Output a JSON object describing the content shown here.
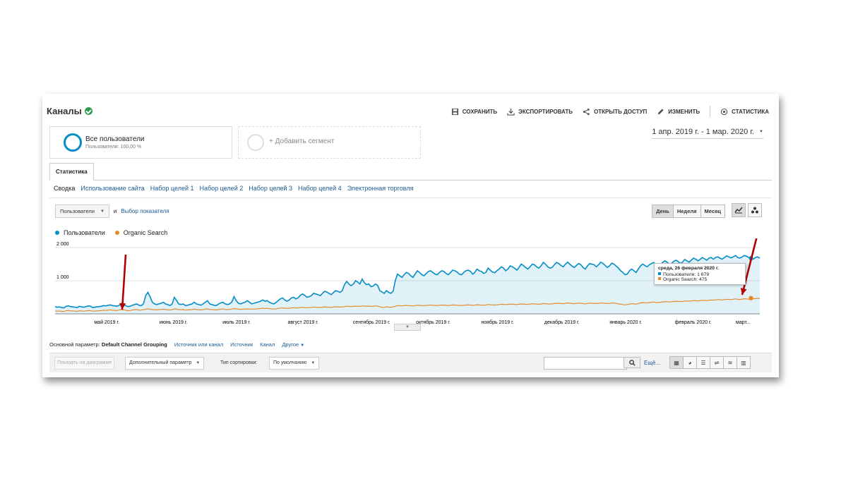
{
  "header": {
    "title": "Каналы",
    "actions": [
      {
        "label": "СОХРАНИТЬ",
        "icon": "save-icon"
      },
      {
        "label": "ЭКСПОРТИРОВАТЬ",
        "icon": "export-icon"
      },
      {
        "label": "ОТКРЫТЬ ДОСТУП",
        "icon": "share-icon"
      },
      {
        "label": "ИЗМЕНИТЬ",
        "icon": "pencil-icon"
      },
      {
        "label": "СТАТИСТИКА",
        "icon": "insights-icon"
      }
    ]
  },
  "segments": {
    "active": {
      "title": "Все пользователи",
      "subtitle": "Пользователи: 100,00 %"
    },
    "add_label": "+ Добавить сегмент"
  },
  "date_range": "1 апр. 2019 г. - 1 мар. 2020 г.",
  "tabs": [
    "Статистика"
  ],
  "subtabs": [
    "Сводка",
    "Использование сайта",
    "Набор целей 1",
    "Набор целей 2",
    "Набор целей 3",
    "Набор целей 4",
    "Электронная торговля"
  ],
  "metric_selector": {
    "selected": "Пользователи",
    "conjunction": "и",
    "add_metric_link": "Выбор показателя"
  },
  "period_buttons": [
    "День",
    "Неделя",
    "Месяц"
  ],
  "chart_data": {
    "type": "line",
    "series": [
      {
        "name": "Пользователи",
        "color": "#058dc7"
      },
      {
        "name": "Organic Search",
        "color": "#e68a2e"
      }
    ],
    "yticks": [
      "2 000",
      "1 000"
    ],
    "ylim": [
      0,
      2000
    ],
    "xticks": [
      "май 2019 г.",
      "июнь 2019 г.",
      "июль 2019 г.",
      "август 2019 г.",
      "сентябрь 2019 г.",
      "октябрь 2019 г.",
      "ноябрь 2019 г.",
      "декабрь 2019 г.",
      "январь 2020 г.",
      "февраль 2020 г.",
      "март..."
    ],
    "start_date": "2019-04-01",
    "end_date": "2020-03-01",
    "users_daily": [
      220,
      200,
      210,
      190,
      180,
      230,
      240,
      220,
      210,
      200,
      190,
      230,
      210,
      200,
      220,
      240,
      230,
      190,
      200,
      210,
      220,
      230,
      250,
      240,
      260,
      270,
      250,
      240,
      230,
      260,
      300,
      280,
      250,
      220,
      230,
      260,
      280,
      300,
      260,
      250,
      300,
      550,
      650,
      520,
      350,
      300,
      280,
      300,
      320,
      350,
      300,
      280,
      250,
      300,
      500,
      400,
      300,
      280,
      300,
      250,
      260,
      280,
      300,
      350,
      300,
      280,
      260,
      300,
      350,
      400,
      300,
      280,
      260,
      250,
      300,
      330,
      350,
      300,
      280,
      300,
      360,
      520,
      400,
      320,
      300,
      330,
      350,
      400,
      350,
      300,
      320,
      340,
      360,
      380,
      420,
      380,
      400,
      350,
      320,
      300,
      340,
      400,
      450,
      480,
      420,
      380,
      420,
      480,
      500,
      450,
      480,
      560,
      600,
      560,
      500,
      520,
      550,
      620,
      600,
      580,
      550,
      620,
      680,
      660,
      620,
      580,
      640,
      700,
      680,
      650,
      700,
      880,
      980,
      900,
      850,
      900,
      1000,
      960,
      900,
      1050,
      940,
      880,
      900,
      820,
      840,
      900,
      860,
      700,
      660,
      620,
      700,
      650,
      620,
      680,
      1000,
      1200,
      1150,
      1100,
      1180,
      1250,
      1220,
      1150,
      1100,
      1200,
      1300,
      1250,
      1180,
      1150,
      1220,
      1280,
      1300,
      1250,
      1200,
      1180,
      1250,
      1300,
      1280,
      1220,
      1180,
      1250,
      1320,
      1300,
      1260,
      1200,
      1180,
      1250,
      1300,
      1320,
      1280,
      1200,
      1250,
      1350,
      1300,
      1280,
      1220,
      1250,
      1380,
      1320,
      1260,
      1240,
      1300,
      1350,
      1420,
      1380,
      1300,
      1350,
      1450,
      1420,
      1380,
      1320,
      1400,
      1500,
      1460,
      1400,
      1350,
      1420,
      1500,
      1480,
      1420,
      1380,
      1450,
      1550,
      1500,
      1420,
      1380,
      1400,
      1480,
      1550,
      1520,
      1460,
      1420,
      1500,
      1560,
      1500,
      1440,
      1400,
      1460,
      1520,
      1480,
      1400,
      1350,
      1450,
      1520,
      1500,
      1480,
      1420,
      1480,
      1560,
      1520,
      1460,
      1400,
      1450,
      1530,
      1500,
      1440,
      1380,
      1300,
      1250,
      1180,
      1200,
      1300,
      1350,
      1300,
      1250,
      1350,
      1450,
      1500,
      1460,
      1420,
      1480,
      1520,
      1550,
      1480,
      1420,
      1480,
      1550,
      1600,
      1560,
      1500,
      1520,
      1580,
      1620,
      1580,
      1520,
      1560,
      1640,
      1600,
      1560,
      1620,
      1680,
      1650,
      1600,
      1640,
      1700,
      1660,
      1620,
      1680,
      1700,
      1650,
      1700,
      1720,
      1680,
      1650,
      1700,
      1750,
      1720,
      1690,
      1720,
      1760,
      1700,
      1680,
      1720,
      1760,
      1740,
      1700,
      1679,
      1650,
      1700,
      1720,
      1680
    ],
    "organic_daily": [
      90,
      80,
      85,
      75,
      70,
      95,
      100,
      90,
      85,
      80,
      75,
      95,
      85,
      80,
      90,
      100,
      95,
      80,
      85,
      90,
      95,
      100,
      110,
      105,
      115,
      120,
      110,
      105,
      100,
      115,
      130,
      120,
      110,
      95,
      100,
      115,
      125,
      130,
      115,
      110,
      130,
      140,
      150,
      140,
      130,
      125,
      120,
      130,
      135,
      140,
      130,
      125,
      115,
      130,
      150,
      140,
      130,
      125,
      130,
      115,
      120,
      125,
      130,
      140,
      130,
      125,
      120,
      130,
      140,
      150,
      135,
      130,
      125,
      120,
      130,
      140,
      145,
      135,
      130,
      135,
      145,
      160,
      150,
      140,
      135,
      140,
      145,
      150,
      145,
      140,
      145,
      150,
      155,
      160,
      170,
      160,
      165,
      155,
      150,
      145,
      150,
      165,
      175,
      180,
      170,
      165,
      170,
      180,
      185,
      175,
      180,
      190,
      200,
      190,
      185,
      190,
      195,
      205,
      200,
      195,
      190,
      200,
      210,
      205,
      200,
      195,
      205,
      215,
      210,
      205,
      210,
      220,
      230,
      225,
      220,
      225,
      235,
      230,
      225,
      240,
      235,
      230,
      235,
      225,
      230,
      240,
      235,
      210,
      200,
      195,
      210,
      205,
      200,
      210,
      230,
      250,
      245,
      240,
      250,
      255,
      250,
      245,
      240,
      250,
      260,
      255,
      250,
      245,
      255,
      260,
      265,
      260,
      255,
      250,
      260,
      265,
      262,
      258,
      250,
      260,
      268,
      265,
      260,
      255,
      250,
      260,
      265,
      270,
      265,
      258,
      262,
      275,
      270,
      265,
      260,
      265,
      280,
      275,
      270,
      265,
      270,
      280,
      290,
      285,
      280,
      285,
      295,
      290,
      285,
      280,
      290,
      300,
      295,
      290,
      285,
      295,
      305,
      300,
      295,
      290,
      295,
      310,
      305,
      300,
      295,
      300,
      310,
      320,
      315,
      310,
      305,
      315,
      330,
      320,
      310,
      305,
      315,
      325,
      320,
      310,
      300,
      315,
      325,
      320,
      318,
      310,
      315,
      330,
      325,
      320,
      310,
      315,
      330,
      325,
      318,
      300,
      290,
      280,
      270,
      280,
      295,
      305,
      300,
      295,
      310,
      330,
      340,
      335,
      330,
      340,
      350,
      355,
      345,
      340,
      350,
      360,
      370,
      365,
      360,
      365,
      375,
      380,
      375,
      370,
      375,
      390,
      385,
      380,
      390,
      400,
      395,
      390,
      400,
      410,
      405,
      400,
      410,
      420,
      415,
      420,
      430,
      425,
      420,
      430,
      440,
      435,
      430,
      440,
      450,
      440,
      435,
      445,
      455,
      450,
      440,
      475,
      450,
      460,
      470,
      455
    ]
  },
  "tooltip": {
    "date": "среда, 26 февраля 2020 г.",
    "users": "Пользователи: 1 679",
    "organic": "Organic Search: 475"
  },
  "dimensions": {
    "label": "Основной параметр:",
    "primary": "Default Channel Grouping",
    "others": [
      "Источник или канал",
      "Источник",
      "Канал"
    ],
    "more": "Другое"
  },
  "table_controls": {
    "plot_rows": "Показать на диаграмме",
    "secondary_dimension": "Дополнительный параметр",
    "sort_label": "Тип сортировки:",
    "sort_value": "По умолчанию",
    "search_value": "",
    "more_link": "Ещё..."
  },
  "colors": {
    "accent_blue": "#058dc7",
    "orange": "#e68a2e",
    "annotation_arrow": "#b30000",
    "link": "#1a5a96"
  }
}
